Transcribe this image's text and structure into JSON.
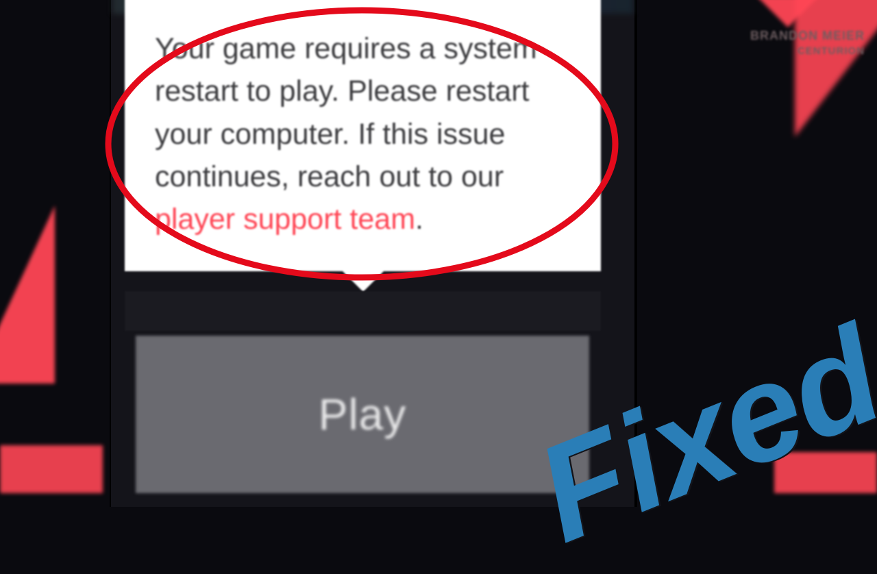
{
  "background": {
    "player_name": "BRANDON MEIER",
    "player_sub": "CENTURION"
  },
  "tooltip": {
    "body_prefix": "Your game requires a system restart to play. Please restart your computer. If this issue continues, reach out to our ",
    "link_text": "player support team",
    "body_suffix": "."
  },
  "play_button": {
    "label": "Play"
  },
  "overlay": {
    "fixed_text": "Fixed"
  },
  "colors": {
    "accent": "#ff4655",
    "link": "#ff4655",
    "overlay_text": "#2a7eb7"
  }
}
